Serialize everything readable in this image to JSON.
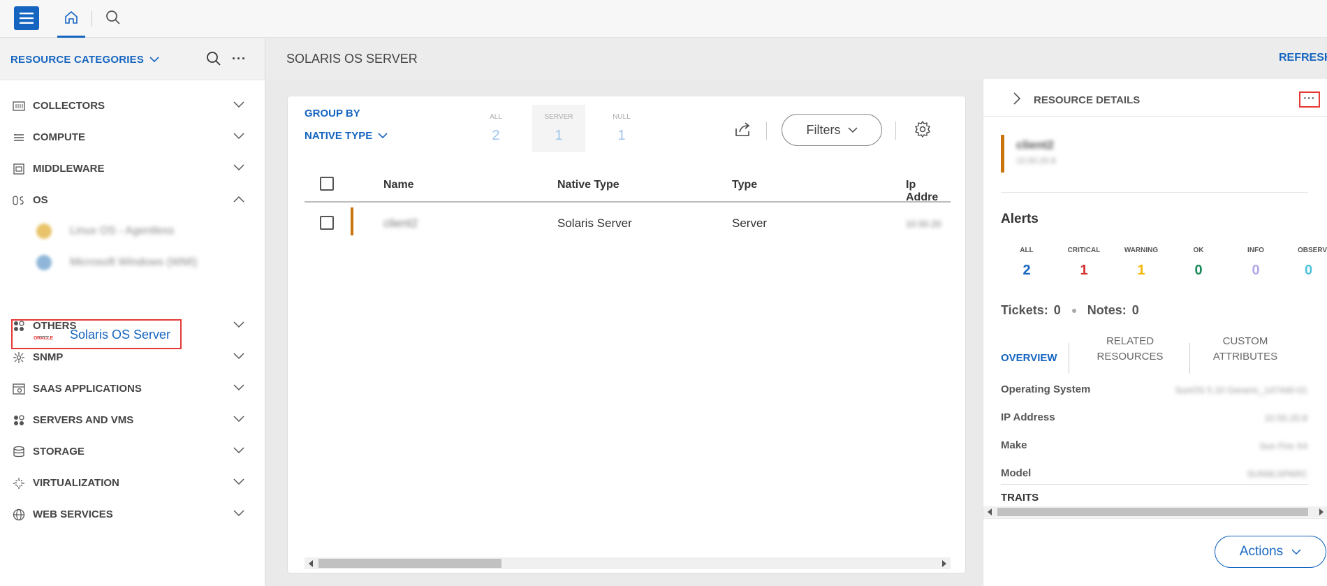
{
  "colors": {
    "accent": "#1565c0",
    "alert_red": "#e53935",
    "row_marker": "#c8750c"
  },
  "topbar": {
    "menu_icon": "hamburger-icon",
    "home_icon": "home-icon",
    "search_icon": "search-icon"
  },
  "sidebar": {
    "header_label": "RESOURCE CATEGORIES",
    "more_label": "···",
    "categories": [
      {
        "label": "COLLECTORS",
        "icon": "collectors-icon"
      },
      {
        "label": "COMPUTE",
        "icon": "compute-icon"
      },
      {
        "label": "MIDDLEWARE",
        "icon": "middleware-icon"
      },
      {
        "label": "OS",
        "icon": "os-icon"
      },
      {
        "label": "OTHERS",
        "icon": "others-icon"
      },
      {
        "label": "SNMP",
        "icon": "snmp-icon"
      },
      {
        "label": "SAAS APPLICATIONS",
        "icon": "saas-icon"
      },
      {
        "label": "SERVERS AND VMS",
        "icon": "servers-icon"
      },
      {
        "label": "STORAGE",
        "icon": "storage-icon"
      },
      {
        "label": "VIRTUALIZATION",
        "icon": "virtualization-icon"
      },
      {
        "label": "WEB SERVICES",
        "icon": "web-services-icon"
      }
    ],
    "os_children": [
      {
        "label": "Linux OS - Agentless",
        "icon": "linux-icon"
      },
      {
        "label": "Microsoft Windows (WMI)",
        "icon": "windows-icon"
      },
      {
        "label": "Solaris OS Server",
        "logo_text": "ORACLE",
        "icon": "oracle-logo"
      }
    ]
  },
  "page": {
    "title": "SOLARIS OS SERVER",
    "refresh": "REFRESH"
  },
  "grid": {
    "group_by_label": "GROUP BY",
    "group_by_value": "NATIVE TYPE",
    "counts": [
      {
        "label": "ALL",
        "value": "2"
      },
      {
        "label": "SERVER",
        "value": "1"
      },
      {
        "label": "NULL",
        "value": "1"
      }
    ],
    "filters_label": "Filters",
    "columns": [
      "Name",
      "Native Type",
      "Type",
      "Ip Addre"
    ],
    "rows": [
      {
        "name": "client2",
        "native_type": "Solaris Server",
        "type": "Server",
        "ip": "10.50.20"
      }
    ]
  },
  "details": {
    "title": "RESOURCE DETAILS",
    "more_label": "···",
    "resource_name": "client2",
    "resource_sub": "10.50.20.8",
    "alerts_title": "Alerts",
    "alerts": [
      {
        "label": "ALL",
        "value": "2",
        "color": "#1565c0"
      },
      {
        "label": "CRITICAL",
        "value": "1",
        "color": "#d32f2f"
      },
      {
        "label": "WARNING",
        "value": "1",
        "color": "#f2b705"
      },
      {
        "label": "OK",
        "value": "0",
        "color": "#1a8a5a"
      },
      {
        "label": "INFO",
        "value": "0",
        "color": "#b3a8e6"
      },
      {
        "label": "OBSERVED",
        "value": "0",
        "color": "#4fc3d9"
      }
    ],
    "tickets_label": "Tickets:",
    "tickets_value": "0",
    "notes_label": "Notes:",
    "notes_value": "0",
    "tabs": [
      "OVERVIEW",
      "RELATED RESOURCES",
      "CUSTOM ATTRIBUTES"
    ],
    "properties": [
      {
        "label": "Operating System",
        "value": "SunOS 5.10 Generic_147440-01"
      },
      {
        "label": "IP Address",
        "value": "10.50.20.8"
      },
      {
        "label": "Make",
        "value": "Sun Fire X4"
      },
      {
        "label": "Model",
        "value": "SUNW,SPARC"
      }
    ],
    "traits_label": "TRAITS",
    "actions_label": "Actions"
  }
}
